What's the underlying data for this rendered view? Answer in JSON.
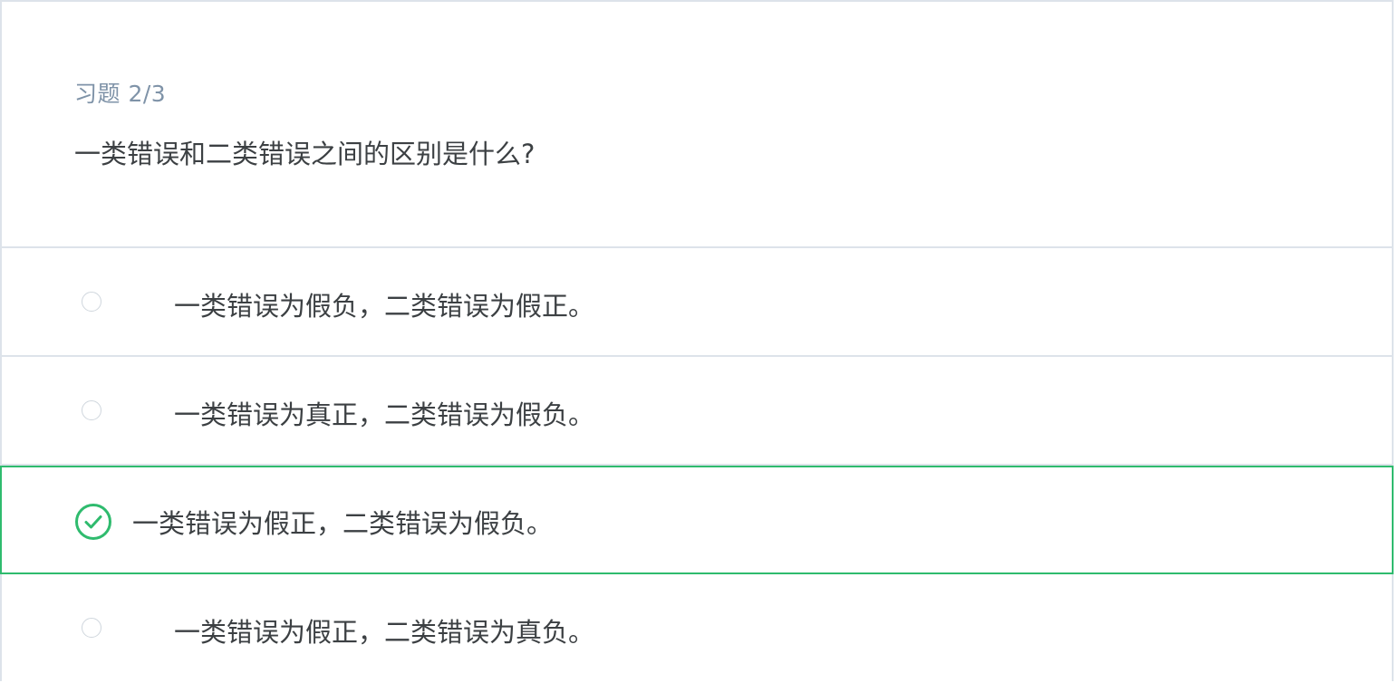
{
  "exercise": {
    "counter": "习题 2/3",
    "question": "一类错误和二类错误之间的区别是什么?"
  },
  "options": [
    {
      "label": "一类错误为假负，二类错误为假正。",
      "selected": false
    },
    {
      "label": "一类错误为真正，二类错误为假负。",
      "selected": false
    },
    {
      "label": "一类错误为假正，二类错误为假负。",
      "selected": true
    },
    {
      "label": "一类错误为假正，二类错误为真负。",
      "selected": false
    }
  ],
  "colors": {
    "accent": "#2fbb6e",
    "border": "#dde3ea",
    "muted_text": "#7f93a8",
    "text": "#3c4043"
  },
  "icons": {
    "selected": "check-circle-icon",
    "unselected": "radio-circle-icon"
  }
}
